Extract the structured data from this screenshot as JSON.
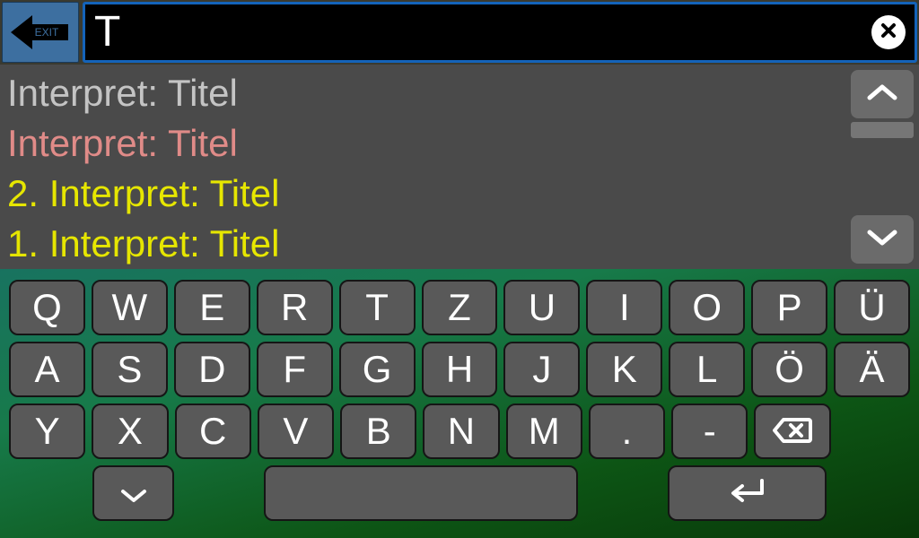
{
  "search": {
    "value": "T"
  },
  "exit_label": "EXIT",
  "results": [
    {
      "text": "Interpret: Titel",
      "tone": "gray"
    },
    {
      "text": "Interpret: Titel",
      "tone": "salmon"
    },
    {
      "text": "2. Interpret: Titel",
      "tone": "yellow"
    },
    {
      "text": "1. Interpret: Titel",
      "tone": "yellow"
    }
  ],
  "keyboard": {
    "row1": [
      "Q",
      "W",
      "E",
      "R",
      "T",
      "Z",
      "U",
      "I",
      "O",
      "P",
      "Ü"
    ],
    "row2": [
      "A",
      "S",
      "D",
      "F",
      "G",
      "H",
      "J",
      "K",
      "L",
      "Ö",
      "Ä"
    ],
    "row3": [
      "Y",
      "X",
      "C",
      "V",
      "B",
      "N",
      "M",
      ".",
      "-"
    ]
  }
}
